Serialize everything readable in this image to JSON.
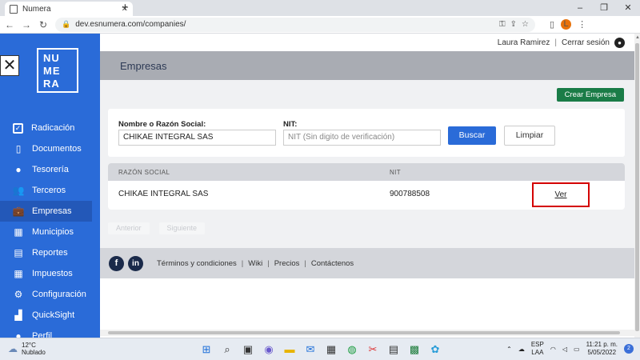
{
  "browser": {
    "tab_title": "Numera",
    "tab_close": "✕",
    "new_tab": "+",
    "url": "dev.esnumera.com/companies/",
    "back": "←",
    "forward": "→",
    "reload": "↻",
    "avatar_letter": "L",
    "minimize": "–",
    "maximize": "❐",
    "close": "✕"
  },
  "sidebar": {
    "logo_lines": [
      "NU",
      "ME",
      "RA"
    ],
    "toggle": "✕",
    "items": [
      {
        "label": "Radicación",
        "icon": "check-icon",
        "glyph": "✓"
      },
      {
        "label": "Documentos",
        "icon": "document-icon",
        "glyph": "▯"
      },
      {
        "label": "Tesorería",
        "icon": "money-bag-icon",
        "glyph": "●"
      },
      {
        "label": "Terceros",
        "icon": "users-icon",
        "glyph": "👥"
      },
      {
        "label": "Empresas",
        "icon": "briefcase-icon",
        "glyph": "💼"
      },
      {
        "label": "Municipios",
        "icon": "map-icon",
        "glyph": "▦"
      },
      {
        "label": "Reportes",
        "icon": "report-icon",
        "glyph": "▤"
      },
      {
        "label": "Impuestos",
        "icon": "calculator-icon",
        "glyph": "▦"
      },
      {
        "label": "Configuración",
        "icon": "gear-icon",
        "glyph": "⚙"
      },
      {
        "label": "QuickSight",
        "icon": "chart-icon",
        "glyph": "▟"
      },
      {
        "label": "Perfil",
        "icon": "profile-icon",
        "glyph": "●"
      }
    ]
  },
  "header": {
    "user_name": "Laura Ramirez",
    "separator": "|",
    "logout": "Cerrar sesión",
    "page_title": "Empresas"
  },
  "actions": {
    "create": "Crear Empresa"
  },
  "filters": {
    "name_label": "Nombre o Razón Social:",
    "name_value": "CHIKAE INTEGRAL SAS",
    "nit_label": "NIT:",
    "nit_placeholder": "NIT (Sin digito de verificación)",
    "search": "Buscar",
    "clear": "Limpiar"
  },
  "table": {
    "columns": [
      "RAZÓN SOCIAL",
      "NIT"
    ],
    "rows": [
      {
        "name": "CHIKAE INTEGRAL SAS",
        "nit": "900788508",
        "action": "Ver"
      }
    ]
  },
  "pager": {
    "prev": "Anterior",
    "next": "Siguiente"
  },
  "footer": {
    "facebook": "f",
    "linkedin": "in",
    "links": [
      "Términos y condiciones",
      "Wiki",
      "Precios",
      "Contáctenos"
    ],
    "sep": "|"
  },
  "taskbar": {
    "temp": "12°C",
    "weather": "Nublado",
    "lang": "ESP",
    "lang_sub": "LAA",
    "time": "11:21 p. m.",
    "date": "5/05/2022",
    "notif": "2"
  }
}
